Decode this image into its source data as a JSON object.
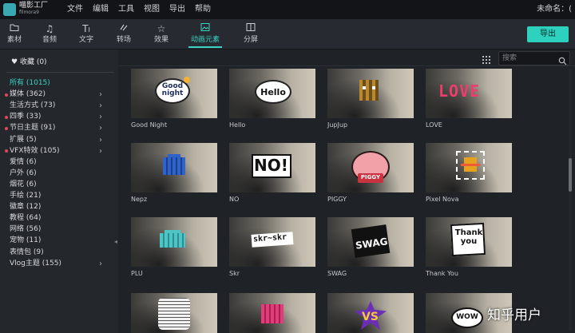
{
  "app": {
    "logo_name": "喵影工厂",
    "logo_sub": "filmora9",
    "project_name": "未命名：("
  },
  "menu": [
    "文件",
    "编辑",
    "工具",
    "视图",
    "导出",
    "帮助"
  ],
  "toolbar": {
    "tabs": [
      {
        "label": "素材",
        "icon": "folder-icon"
      },
      {
        "label": "音频",
        "icon": "music-note-icon"
      },
      {
        "label": "文字",
        "icon": "text-icon"
      },
      {
        "label": "转场",
        "icon": "transition-icon"
      },
      {
        "label": "效果",
        "icon": "effects-icon"
      },
      {
        "label": "动画元素",
        "icon": "image-icon"
      },
      {
        "label": "分屏",
        "icon": "split-screen-icon"
      }
    ],
    "active_tab": "动画元素",
    "export_label": "导出"
  },
  "colors": {
    "accent": "#39d3c2",
    "export_bg": "#2dd1bd",
    "new_dot": "#e0475b"
  },
  "sidebar": {
    "favorites": "收藏 (0)",
    "categories": [
      {
        "label": "所有 (1015)",
        "active": true,
        "dot": false,
        "arrow": false
      },
      {
        "label": "媒体 (362)",
        "dot": true,
        "arrow": true
      },
      {
        "label": "生活方式 (73)",
        "dot": false,
        "arrow": true
      },
      {
        "label": "四季 (33)",
        "dot": true,
        "arrow": true
      },
      {
        "label": "节日主题 (91)",
        "dot": true,
        "arrow": true
      },
      {
        "label": "扩展 (5)",
        "dot": false,
        "arrow": true
      },
      {
        "label": "VFX特效 (105)",
        "dot": true,
        "arrow": true
      },
      {
        "label": "爱情 (6)",
        "dot": false,
        "arrow": false
      },
      {
        "label": "户外 (6)",
        "dot": false,
        "arrow": false
      },
      {
        "label": "烟花 (6)",
        "dot": false,
        "arrow": false
      },
      {
        "label": "手绘 (21)",
        "dot": false,
        "arrow": false
      },
      {
        "label": "徽章 (12)",
        "dot": false,
        "arrow": false
      },
      {
        "label": "教程 (64)",
        "dot": false,
        "arrow": false
      },
      {
        "label": "网络 (56)",
        "dot": false,
        "arrow": false
      },
      {
        "label": "宠物 (11)",
        "dot": false,
        "arrow": false
      },
      {
        "label": "表情包 (9)",
        "dot": false,
        "arrow": false
      },
      {
        "label": "Vlog主题 (155)",
        "dot": false,
        "arrow": true
      }
    ]
  },
  "search": {
    "placeholder": "搜索"
  },
  "elements": [
    {
      "label": "Good Night",
      "sticker_text": "Good night"
    },
    {
      "label": "Hello",
      "sticker_text": "Hello"
    },
    {
      "label": "JupJup",
      "sticker_text": ""
    },
    {
      "label": "LOVE",
      "sticker_text": "LOVE"
    },
    {
      "label": "Nepz",
      "sticker_text": ""
    },
    {
      "label": "NO",
      "sticker_text": "NO!"
    },
    {
      "label": "PIGGY",
      "sticker_text": "PIGGY"
    },
    {
      "label": "Pixel Nova",
      "sticker_text": ""
    },
    {
      "label": "PLU",
      "sticker_text": ""
    },
    {
      "label": "Skr",
      "sticker_text": "skr~skr"
    },
    {
      "label": "SWAG",
      "sticker_text": "SWAG"
    },
    {
      "label": "Thank You",
      "sticker_text": "Thank you"
    },
    {
      "label": "",
      "sticker_text": ""
    },
    {
      "label": "",
      "sticker_text": ""
    },
    {
      "label": "",
      "sticker_text": "VS"
    },
    {
      "label": "",
      "sticker_text": "WOW"
    }
  ],
  "watermark": "知乎用户"
}
